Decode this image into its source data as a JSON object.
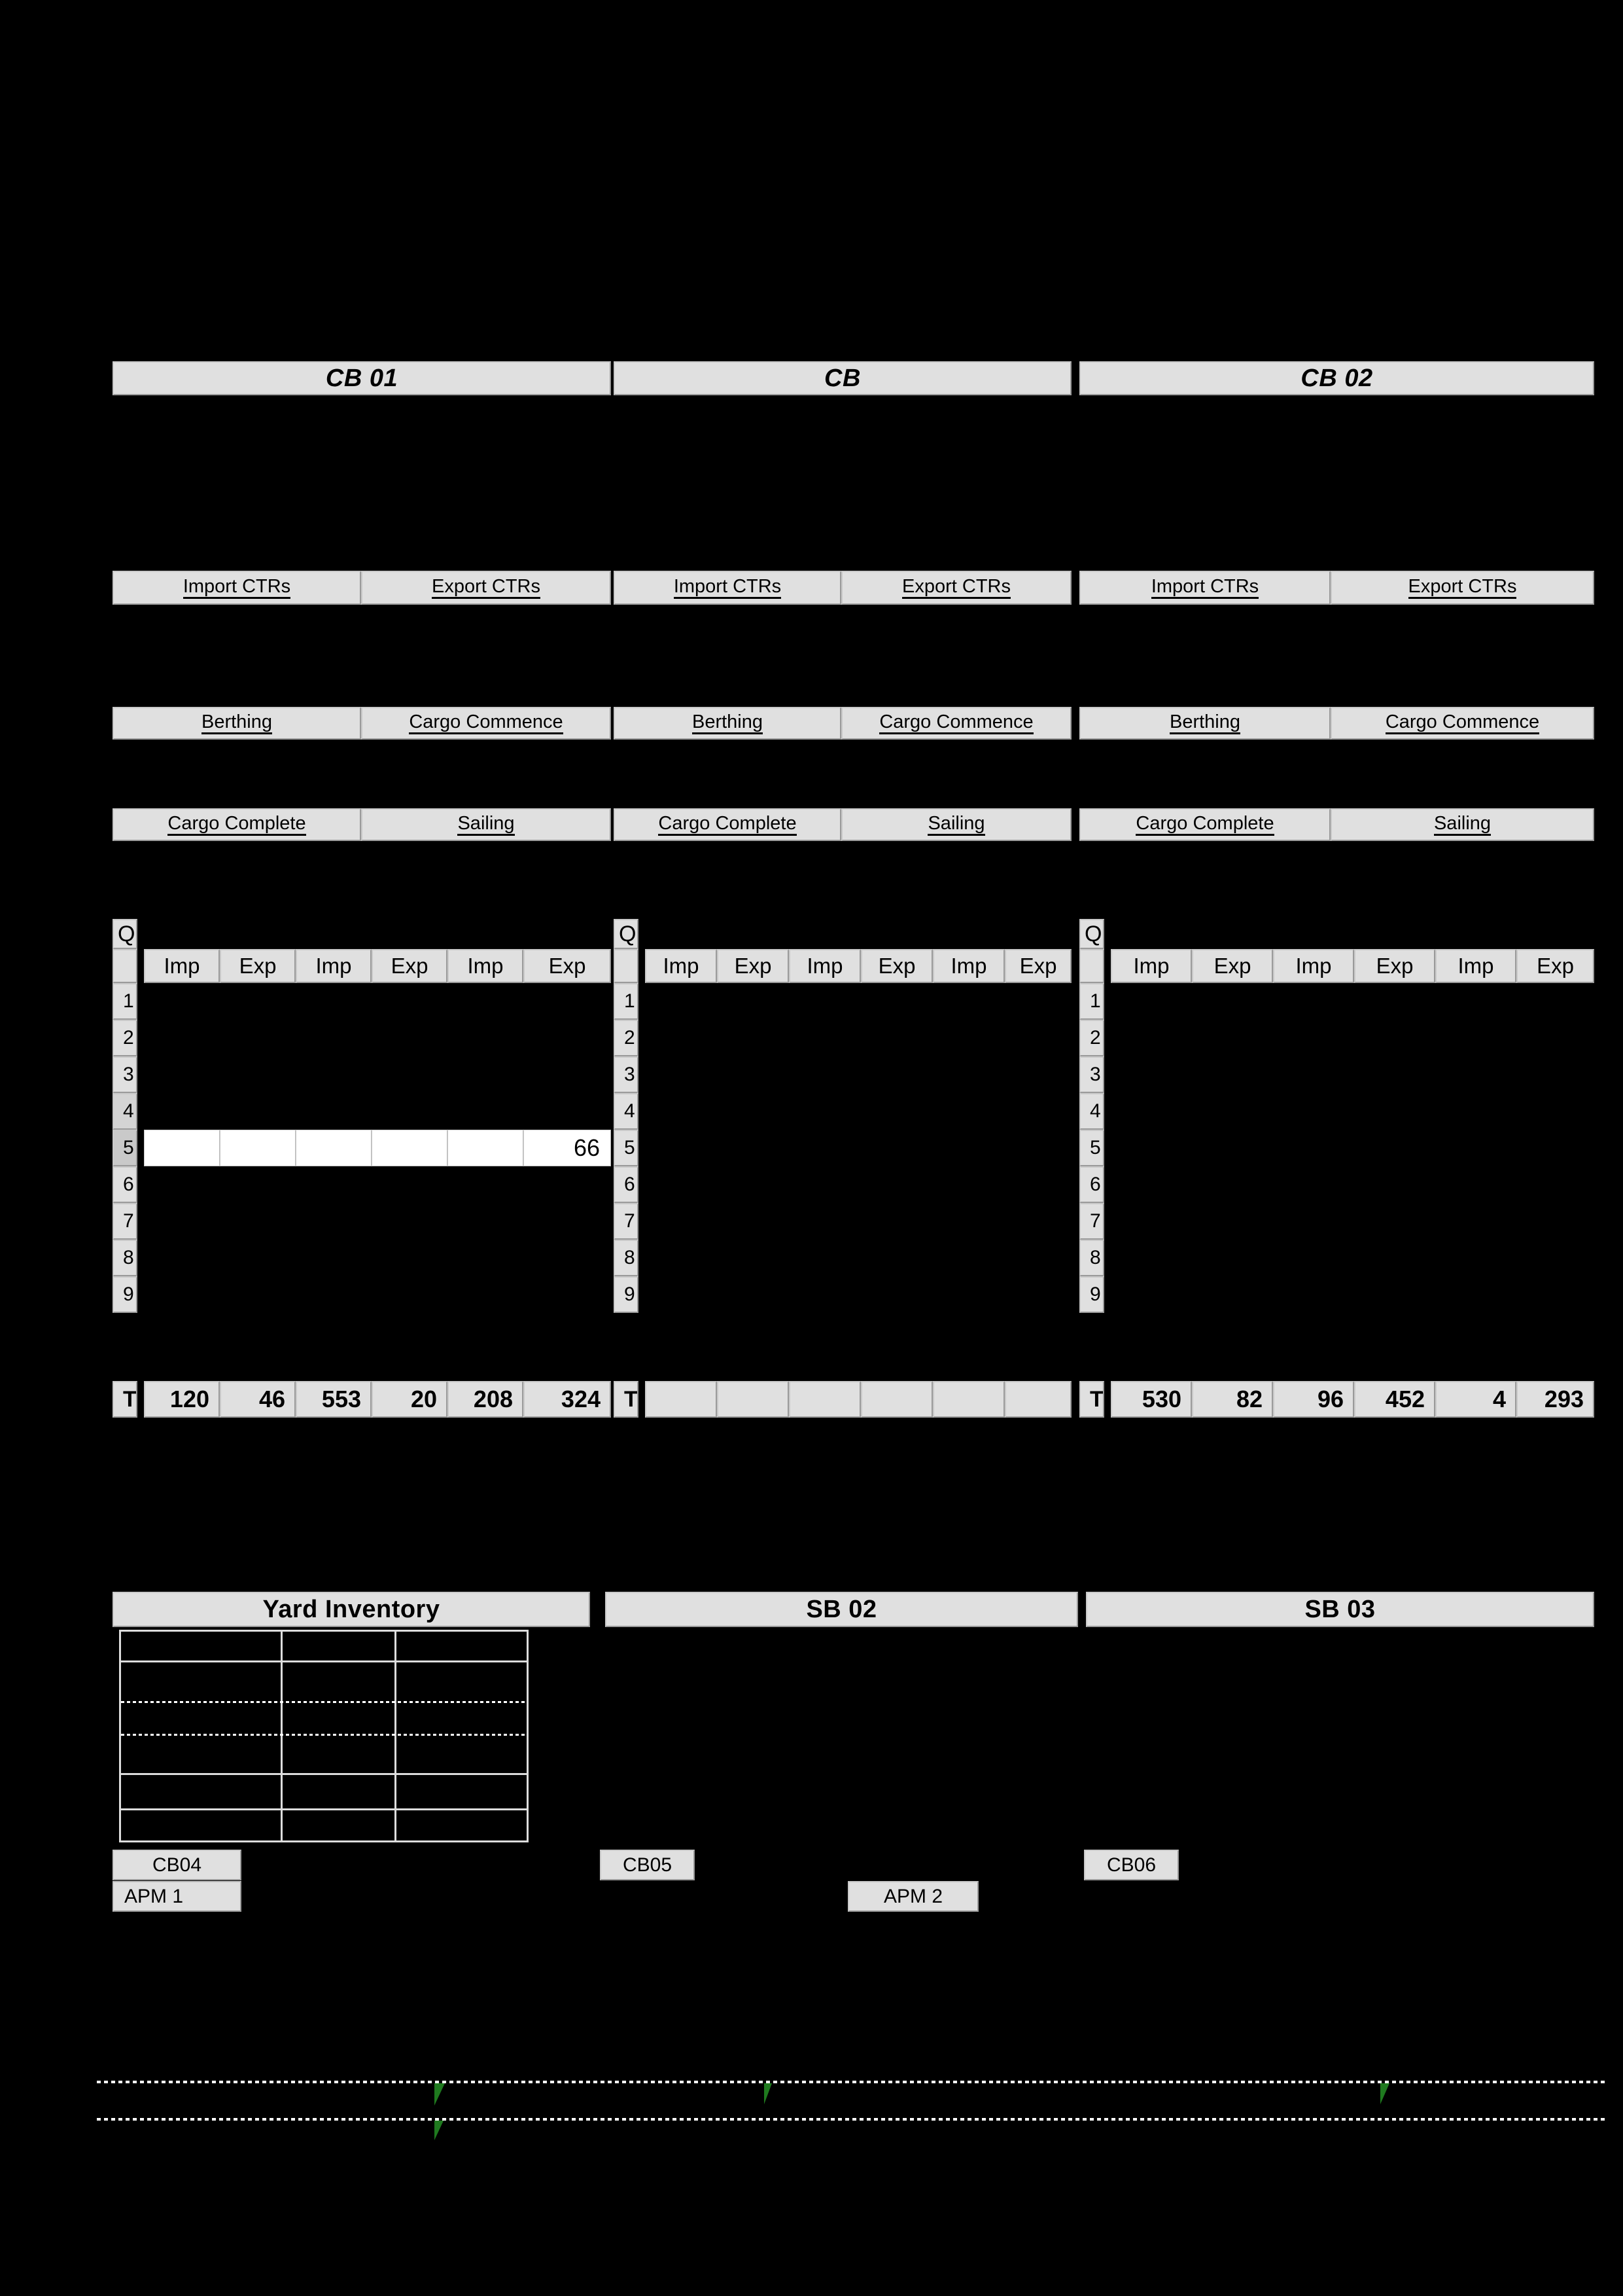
{
  "page": {
    "background": "#000000",
    "cell_fill": "#e0e0e0",
    "accent_green": "#1f7a1f"
  },
  "berth_sections": [
    {
      "title": "CB 01"
    },
    {
      "title": "CB"
    },
    {
      "title": "CB 02"
    }
  ],
  "label_rows": [
    {
      "name": "ctr-row",
      "labels": [
        "Import CTRs",
        "Export CTRs"
      ]
    },
    {
      "name": "berth-row",
      "labels": [
        "Berthing",
        "Cargo Commence"
      ]
    },
    {
      "name": "cargo-row",
      "labels": [
        "Cargo Complete",
        "Sailing"
      ]
    }
  ],
  "grid": {
    "corner_label": "Q",
    "column_headers": [
      "Imp",
      "Exp",
      "Imp",
      "Exp",
      "Imp",
      "Exp"
    ],
    "row_labels": [
      "1",
      "2",
      "3",
      "4",
      "5",
      "6",
      "7",
      "8",
      "9"
    ],
    "total_label": "T",
    "selected_row": "5",
    "tables": [
      {
        "name": "cb01-grid",
        "totals": [
          "120",
          "46",
          "553",
          "20",
          "208",
          "324"
        ],
        "highlight_row": "5",
        "highlight_values": [
          "",
          "",
          "",
          "",
          "",
          "66"
        ]
      },
      {
        "name": "cb-grid",
        "totals": [
          "",
          "",
          "",
          "",
          "",
          ""
        ],
        "highlight_row": "",
        "highlight_values": [
          "",
          "",
          "",
          "",
          "",
          ""
        ]
      },
      {
        "name": "cb02-grid",
        "totals": [
          "530",
          "82",
          "96",
          "452",
          "4",
          "293"
        ],
        "highlight_row": "",
        "highlight_values": [
          "",
          "",
          "",
          "",
          "",
          ""
        ]
      }
    ]
  },
  "yard_sections": [
    {
      "title": "Yard Inventory"
    },
    {
      "title": "SB 02"
    },
    {
      "title": "SB 03"
    }
  ],
  "tags": {
    "berth_tags": [
      "CB04",
      "CB05",
      "CB06"
    ],
    "apm_tags": [
      "APM 1",
      "APM 2"
    ]
  }
}
